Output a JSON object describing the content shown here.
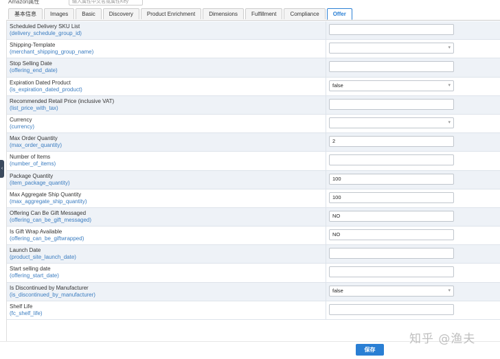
{
  "header": {
    "attr_label": "Amazon属性",
    "search_placeholder": "输入属性中文名或属性Key"
  },
  "tabs": [
    {
      "label": "基本信息",
      "active": false
    },
    {
      "label": "Images",
      "active": false
    },
    {
      "label": "Basic",
      "active": false
    },
    {
      "label": "Discovery",
      "active": false
    },
    {
      "label": "Product Enrichment",
      "active": false
    },
    {
      "label": "Dimensions",
      "active": false
    },
    {
      "label": "Fulfillment",
      "active": false
    },
    {
      "label": "Compliance",
      "active": false
    },
    {
      "label": "Offer",
      "active": true
    }
  ],
  "rows": [
    {
      "label": "Scheduled Delivery SKU List",
      "key": "(delivery_schedule_group_id)",
      "value": "",
      "type": "text"
    },
    {
      "label": "Shipping-Template",
      "key": "(merchant_shipping_group_name)",
      "value": "",
      "type": "select"
    },
    {
      "label": "Stop Selling Date",
      "key": "(offering_end_date)",
      "value": "",
      "type": "text"
    },
    {
      "label": "Expiration Dated Product",
      "key": "(is_expiration_dated_product)",
      "value": "false",
      "type": "select"
    },
    {
      "label": "Recommended Retail Price (inclusive VAT)",
      "key": "(list_price_with_tax)",
      "value": "",
      "type": "text"
    },
    {
      "label": "Currency",
      "key": "(currency)",
      "value": "",
      "type": "select"
    },
    {
      "label": "Max Order Quantity",
      "key": "(max_order_quantity)",
      "value": "2",
      "type": "text"
    },
    {
      "label": "Number of Items",
      "key": "(number_of_items)",
      "value": "",
      "type": "text"
    },
    {
      "label": "Package Quantity",
      "key": "(item_package_quantity)",
      "value": "100",
      "type": "text"
    },
    {
      "label": "Max Aggregate Ship Quantity",
      "key": "(max_aggregate_ship_quantity)",
      "value": "100",
      "type": "text"
    },
    {
      "label": "Offering Can Be Gift Messaged",
      "key": "(offering_can_be_gift_messaged)",
      "value": "NO",
      "type": "text"
    },
    {
      "label": "Is Gift Wrap Available",
      "key": "(offering_can_be_giftwrapped)",
      "value": "NO",
      "type": "text"
    },
    {
      "label": "Launch Date",
      "key": "(product_site_launch_date)",
      "value": "",
      "type": "text"
    },
    {
      "label": "Start selling date",
      "key": "(offering_start_date)",
      "value": "",
      "type": "text"
    },
    {
      "label": "Is Discontinued by Manufacturer",
      "key": "(is_discontinued_by_manufacturer)",
      "value": "false",
      "type": "select"
    },
    {
      "label": "Shelf Life",
      "key": "(fc_shelf_life)",
      "value": "",
      "type": "text"
    }
  ],
  "footer": {
    "save_label": "保存"
  },
  "watermark": "知乎 @渔夫",
  "colors": {
    "accent": "#2a7fd4",
    "key_text": "#3a7cc0",
    "row_alt": "#eef2f7"
  }
}
